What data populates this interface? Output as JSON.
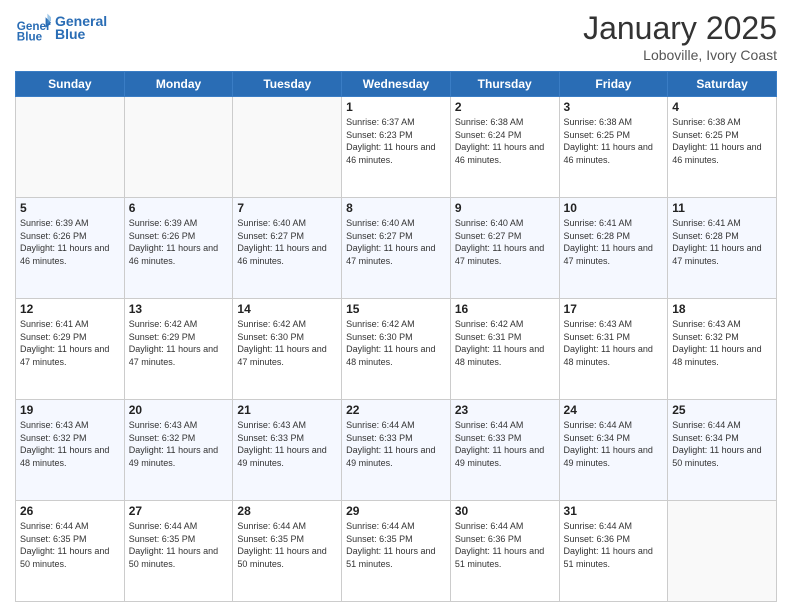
{
  "header": {
    "logo_line1": "General",
    "logo_line2": "Blue",
    "month_title": "January 2025",
    "subtitle": "Loboville, Ivory Coast"
  },
  "days_of_week": [
    "Sunday",
    "Monday",
    "Tuesday",
    "Wednesday",
    "Thursday",
    "Friday",
    "Saturday"
  ],
  "weeks": [
    [
      {
        "day": "",
        "empty": true
      },
      {
        "day": "",
        "empty": true
      },
      {
        "day": "",
        "empty": true
      },
      {
        "day": "1",
        "sunrise": "6:37 AM",
        "sunset": "6:23 PM",
        "daylight": "11 hours and 46 minutes."
      },
      {
        "day": "2",
        "sunrise": "6:38 AM",
        "sunset": "6:24 PM",
        "daylight": "11 hours and 46 minutes."
      },
      {
        "day": "3",
        "sunrise": "6:38 AM",
        "sunset": "6:25 PM",
        "daylight": "11 hours and 46 minutes."
      },
      {
        "day": "4",
        "sunrise": "6:38 AM",
        "sunset": "6:25 PM",
        "daylight": "11 hours and 46 minutes."
      }
    ],
    [
      {
        "day": "5",
        "sunrise": "6:39 AM",
        "sunset": "6:26 PM",
        "daylight": "11 hours and 46 minutes."
      },
      {
        "day": "6",
        "sunrise": "6:39 AM",
        "sunset": "6:26 PM",
        "daylight": "11 hours and 46 minutes."
      },
      {
        "day": "7",
        "sunrise": "6:40 AM",
        "sunset": "6:27 PM",
        "daylight": "11 hours and 46 minutes."
      },
      {
        "day": "8",
        "sunrise": "6:40 AM",
        "sunset": "6:27 PM",
        "daylight": "11 hours and 47 minutes."
      },
      {
        "day": "9",
        "sunrise": "6:40 AM",
        "sunset": "6:27 PM",
        "daylight": "11 hours and 47 minutes."
      },
      {
        "day": "10",
        "sunrise": "6:41 AM",
        "sunset": "6:28 PM",
        "daylight": "11 hours and 47 minutes."
      },
      {
        "day": "11",
        "sunrise": "6:41 AM",
        "sunset": "6:28 PM",
        "daylight": "11 hours and 47 minutes."
      }
    ],
    [
      {
        "day": "12",
        "sunrise": "6:41 AM",
        "sunset": "6:29 PM",
        "daylight": "11 hours and 47 minutes."
      },
      {
        "day": "13",
        "sunrise": "6:42 AM",
        "sunset": "6:29 PM",
        "daylight": "11 hours and 47 minutes."
      },
      {
        "day": "14",
        "sunrise": "6:42 AM",
        "sunset": "6:30 PM",
        "daylight": "11 hours and 47 minutes."
      },
      {
        "day": "15",
        "sunrise": "6:42 AM",
        "sunset": "6:30 PM",
        "daylight": "11 hours and 48 minutes."
      },
      {
        "day": "16",
        "sunrise": "6:42 AM",
        "sunset": "6:31 PM",
        "daylight": "11 hours and 48 minutes."
      },
      {
        "day": "17",
        "sunrise": "6:43 AM",
        "sunset": "6:31 PM",
        "daylight": "11 hours and 48 minutes."
      },
      {
        "day": "18",
        "sunrise": "6:43 AM",
        "sunset": "6:32 PM",
        "daylight": "11 hours and 48 minutes."
      }
    ],
    [
      {
        "day": "19",
        "sunrise": "6:43 AM",
        "sunset": "6:32 PM",
        "daylight": "11 hours and 48 minutes."
      },
      {
        "day": "20",
        "sunrise": "6:43 AM",
        "sunset": "6:32 PM",
        "daylight": "11 hours and 49 minutes."
      },
      {
        "day": "21",
        "sunrise": "6:43 AM",
        "sunset": "6:33 PM",
        "daylight": "11 hours and 49 minutes."
      },
      {
        "day": "22",
        "sunrise": "6:44 AM",
        "sunset": "6:33 PM",
        "daylight": "11 hours and 49 minutes."
      },
      {
        "day": "23",
        "sunrise": "6:44 AM",
        "sunset": "6:33 PM",
        "daylight": "11 hours and 49 minutes."
      },
      {
        "day": "24",
        "sunrise": "6:44 AM",
        "sunset": "6:34 PM",
        "daylight": "11 hours and 49 minutes."
      },
      {
        "day": "25",
        "sunrise": "6:44 AM",
        "sunset": "6:34 PM",
        "daylight": "11 hours and 50 minutes."
      }
    ],
    [
      {
        "day": "26",
        "sunrise": "6:44 AM",
        "sunset": "6:35 PM",
        "daylight": "11 hours and 50 minutes."
      },
      {
        "day": "27",
        "sunrise": "6:44 AM",
        "sunset": "6:35 PM",
        "daylight": "11 hours and 50 minutes."
      },
      {
        "day": "28",
        "sunrise": "6:44 AM",
        "sunset": "6:35 PM",
        "daylight": "11 hours and 50 minutes."
      },
      {
        "day": "29",
        "sunrise": "6:44 AM",
        "sunset": "6:35 PM",
        "daylight": "11 hours and 51 minutes."
      },
      {
        "day": "30",
        "sunrise": "6:44 AM",
        "sunset": "6:36 PM",
        "daylight": "11 hours and 51 minutes."
      },
      {
        "day": "31",
        "sunrise": "6:44 AM",
        "sunset": "6:36 PM",
        "daylight": "11 hours and 51 minutes."
      },
      {
        "day": "",
        "empty": true
      }
    ]
  ]
}
